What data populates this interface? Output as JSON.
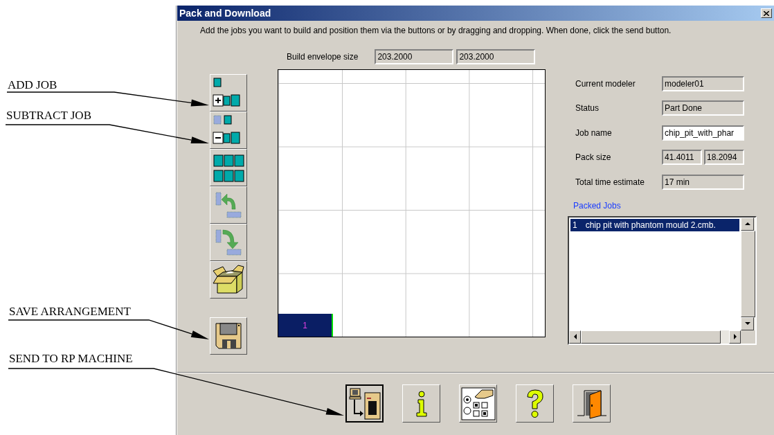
{
  "window": {
    "title": "Pack and Download"
  },
  "instructions": "Add the jobs you want to build and position them via the buttons or by dragging and dropping. When done, click the send button.",
  "build_envelope": {
    "label": "Build envelope size",
    "values": [
      "203.2000",
      "203.2000"
    ]
  },
  "toolbar": [
    {
      "kind": "add"
    },
    {
      "kind": "subtract"
    },
    {
      "kind": "grid"
    },
    {
      "kind": "undo"
    },
    {
      "kind": "redo"
    },
    {
      "kind": "pack"
    },
    {
      "kind": "save"
    }
  ],
  "build_plate": {
    "jobs": [
      {
        "label": "1"
      }
    ]
  },
  "properties": [
    {
      "label": "Current modeler",
      "values": [
        "modeler01"
      ],
      "editable": false
    },
    {
      "label": "Status",
      "values": [
        "Part Done"
      ],
      "editable": false
    },
    {
      "label": "Job name",
      "values": [
        "chip_pit_with_phar"
      ],
      "editable": true
    },
    {
      "label": "Pack size",
      "values": [
        "41.4011",
        "18.2094"
      ],
      "editable": false
    },
    {
      "label": "Total time estimate",
      "values": [
        "17 min"
      ],
      "editable": false
    }
  ],
  "packed_jobs": {
    "title": "Packed Jobs",
    "items": [
      {
        "number": "1",
        "name": "chip pit with phantom mould 2.cmb.",
        "selected": true
      }
    ]
  },
  "actions": [
    {
      "kind": "send",
      "default": true
    },
    {
      "kind": "info",
      "default": false
    },
    {
      "kind": "options",
      "default": false
    },
    {
      "kind": "help",
      "default": false
    },
    {
      "kind": "exit",
      "default": false
    }
  ],
  "callouts": [
    {
      "text": "ADD JOB"
    },
    {
      "text": "SUBTRACT JOB"
    },
    {
      "text": "SAVE ARRANGEMENT"
    },
    {
      "text": "SEND TO RP MACHINE"
    }
  ]
}
